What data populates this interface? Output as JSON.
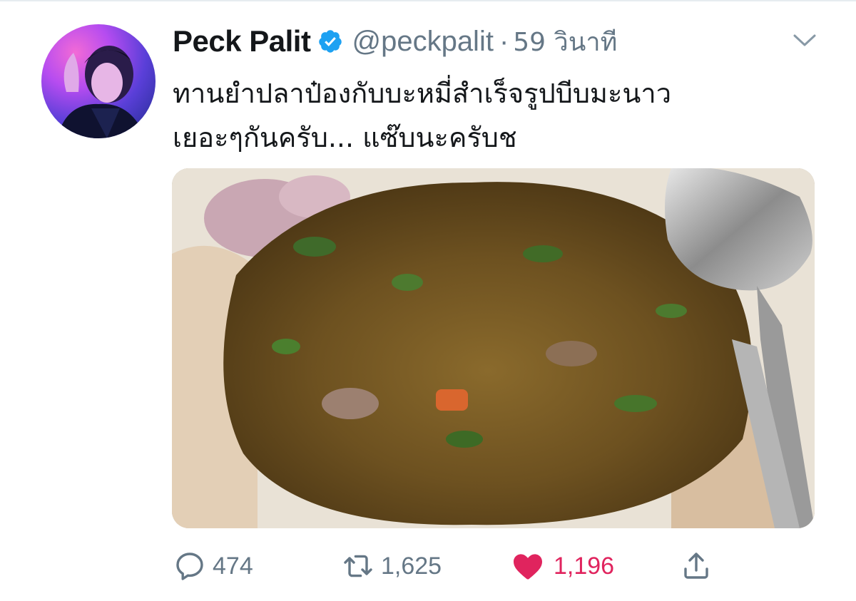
{
  "tweet": {
    "author_name": "Peck Palit",
    "handle": "@peckpalit",
    "separator": "·",
    "time_ago": "59 วินาที",
    "text_lines": [
      "ทานยำปลาป๋องกับบะหมี่สำเร็จรูปบีบมะนาว",
      "เยอะๆกันครับ... แซ๊บนะครับช"
    ],
    "media_alt": "spicy canned fish salad over instant noodles with a spoon and fork"
  },
  "actions": {
    "reply_count": "474",
    "retweet_count": "1,625",
    "like_count": "1,196"
  },
  "icons": {
    "verified": "verified-badge-icon",
    "menu": "chevron-down-icon",
    "reply": "reply-icon",
    "retweet": "retweet-icon",
    "like": "heart-icon",
    "share": "share-icon"
  },
  "colors": {
    "text_primary": "#14171a",
    "text_secondary": "#657786",
    "verified_blue": "#1da1f2",
    "like_red": "#e0245e"
  }
}
